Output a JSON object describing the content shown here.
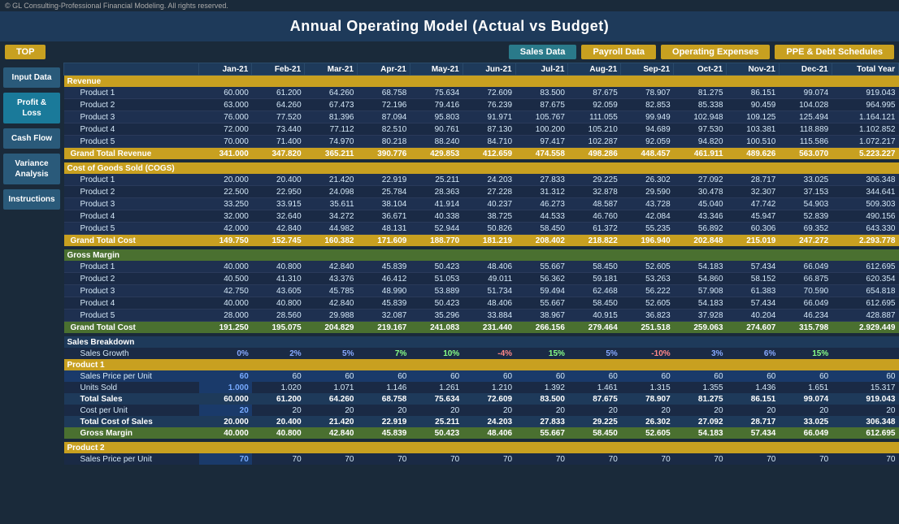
{
  "app": {
    "copyright": "© GL Consulting-Professional Financial Modeling. All rights reserved.",
    "title": "Annual Operating Model (Actual vs Budget)"
  },
  "nav": {
    "top_label": "TOP",
    "buttons": [
      "Sales Data",
      "Payroll Data",
      "Operating Expenses",
      "PPE & Debt Schedules"
    ]
  },
  "sidebar": {
    "items": [
      {
        "label": "Input Data"
      },
      {
        "label": "Profit &\nLoss"
      },
      {
        "label": "Cash Flow"
      },
      {
        "label": "Variance\nAnalysis"
      },
      {
        "label": "Instructions"
      }
    ]
  },
  "columns": [
    "Jan-21",
    "Feb-21",
    "Mar-21",
    "Apr-21",
    "May-21",
    "Jun-21",
    "Jul-21",
    "Aug-21",
    "Sep-21",
    "Oct-21",
    "Nov-21",
    "Dec-21",
    "Total Year"
  ],
  "revenue": {
    "section_label": "Revenue",
    "products": [
      {
        "name": "Product 1",
        "values": [
          "60.000",
          "61.200",
          "64.260",
          "68.758",
          "75.634",
          "72.609",
          "83.500",
          "87.675",
          "78.907",
          "81.275",
          "86.151",
          "99.074",
          "919.043"
        ]
      },
      {
        "name": "Product 2",
        "values": [
          "63.000",
          "64.260",
          "67.473",
          "72.196",
          "79.416",
          "76.239",
          "87.675",
          "92.059",
          "82.853",
          "85.338",
          "90.459",
          "104.028",
          "964.995"
        ]
      },
      {
        "name": "Product 3",
        "values": [
          "76.000",
          "77.520",
          "81.396",
          "87.094",
          "95.803",
          "91.971",
          "105.767",
          "111.055",
          "99.949",
          "102.948",
          "109.125",
          "125.494",
          "1.164.121"
        ]
      },
      {
        "name": "Product 4",
        "values": [
          "72.000",
          "73.440",
          "77.112",
          "82.510",
          "90.761",
          "87.130",
          "100.200",
          "105.210",
          "94.689",
          "97.530",
          "103.381",
          "118.889",
          "1.102.852"
        ]
      },
      {
        "name": "Product 5",
        "values": [
          "70.000",
          "71.400",
          "74.970",
          "80.218",
          "88.240",
          "84.710",
          "97.417",
          "102.287",
          "92.059",
          "94.820",
          "100.510",
          "115.586",
          "1.072.217"
        ]
      }
    ],
    "total_label": "Grand Total Revenue",
    "totals": [
      "341.000",
      "347.820",
      "365.211",
      "390.776",
      "429.853",
      "412.659",
      "474.558",
      "498.286",
      "448.457",
      "461.911",
      "489.626",
      "563.070",
      "5.223.227"
    ]
  },
  "cogs": {
    "section_label": "Cost of Goods Sold (COGS)",
    "products": [
      {
        "name": "Product 1",
        "values": [
          "20.000",
          "20.400",
          "21.420",
          "22.919",
          "25.211",
          "24.203",
          "27.833",
          "29.225",
          "26.302",
          "27.092",
          "28.717",
          "33.025",
          "306.348"
        ]
      },
      {
        "name": "Product 2",
        "values": [
          "22.500",
          "22.950",
          "24.098",
          "25.784",
          "28.363",
          "27.228",
          "31.312",
          "32.878",
          "29.590",
          "30.478",
          "32.307",
          "37.153",
          "344.641"
        ]
      },
      {
        "name": "Product 3",
        "values": [
          "33.250",
          "33.915",
          "35.611",
          "38.104",
          "41.914",
          "40.237",
          "46.273",
          "48.587",
          "43.728",
          "45.040",
          "47.742",
          "54.903",
          "509.303"
        ]
      },
      {
        "name": "Product 4",
        "values": [
          "32.000",
          "32.640",
          "34.272",
          "36.671",
          "40.338",
          "38.725",
          "44.533",
          "46.760",
          "42.084",
          "43.346",
          "45.947",
          "52.839",
          "490.156"
        ]
      },
      {
        "name": "Product 5",
        "values": [
          "42.000",
          "42.840",
          "44.982",
          "48.131",
          "52.944",
          "50.826",
          "58.450",
          "61.372",
          "55.235",
          "56.892",
          "60.306",
          "69.352",
          "643.330"
        ]
      }
    ],
    "total_label": "Grand Total Cost",
    "totals": [
      "149.750",
      "152.745",
      "160.382",
      "171.609",
      "188.770",
      "181.219",
      "208.402",
      "218.822",
      "196.940",
      "202.848",
      "215.019",
      "247.272",
      "2.293.778"
    ]
  },
  "gross_margin": {
    "section_label": "Gross Margin",
    "products": [
      {
        "name": "Product 1",
        "values": [
          "40.000",
          "40.800",
          "42.840",
          "45.839",
          "50.423",
          "48.406",
          "55.667",
          "58.450",
          "52.605",
          "54.183",
          "57.434",
          "66.049",
          "612.695"
        ]
      },
      {
        "name": "Product 2",
        "values": [
          "40.500",
          "41.310",
          "43.376",
          "46.412",
          "51.053",
          "49.011",
          "56.362",
          "59.181",
          "53.263",
          "54.860",
          "58.152",
          "66.875",
          "620.354"
        ]
      },
      {
        "name": "Product 3",
        "values": [
          "42.750",
          "43.605",
          "45.785",
          "48.990",
          "53.889",
          "51.734",
          "59.494",
          "62.468",
          "56.222",
          "57.908",
          "61.383",
          "70.590",
          "654.818"
        ]
      },
      {
        "name": "Product 4",
        "values": [
          "40.000",
          "40.800",
          "42.840",
          "45.839",
          "50.423",
          "48.406",
          "55.667",
          "58.450",
          "52.605",
          "54.183",
          "57.434",
          "66.049",
          "612.695"
        ]
      },
      {
        "name": "Product 5",
        "values": [
          "28.000",
          "28.560",
          "29.988",
          "32.087",
          "35.296",
          "33.884",
          "38.967",
          "40.915",
          "36.823",
          "37.928",
          "40.204",
          "46.234",
          "428.887"
        ]
      }
    ],
    "total_label": "Grand Total Cost",
    "totals": [
      "191.250",
      "195.075",
      "204.829",
      "219.167",
      "241.083",
      "231.440",
      "266.156",
      "279.464",
      "251.518",
      "259.063",
      "274.607",
      "315.798",
      "2.929.449"
    ]
  },
  "sales_breakdown": {
    "section_label": "Sales Breakdown",
    "growth_label": "Sales Growth",
    "growth_values": [
      "0%",
      "2%",
      "5%",
      "7%",
      "10%",
      "-4%",
      "15%",
      "5%",
      "-10%",
      "3%",
      "6%",
      "15%"
    ],
    "product1": {
      "label": "Product 1",
      "price_label": "Sales Price per Unit",
      "price_values": [
        "60",
        "60",
        "60",
        "60",
        "60",
        "60",
        "60",
        "60",
        "60",
        "60",
        "60",
        "60",
        "60"
      ],
      "price_first": "60",
      "units_label": "Units Sold",
      "units_values": [
        "1.000",
        "1.020",
        "1.071",
        "1.146",
        "1.261",
        "1.210",
        "1.392",
        "1.461",
        "1.315",
        "1.355",
        "1.436",
        "1.651",
        "15.317"
      ],
      "units_first": "1.000",
      "total_sales_label": "Total Sales",
      "total_sales_values": [
        "60.000",
        "61.200",
        "64.260",
        "68.758",
        "75.634",
        "72.609",
        "83.500",
        "87.675",
        "78.907",
        "81.275",
        "86.151",
        "99.074",
        "919.043"
      ],
      "cost_label": "Cost per Unit",
      "cost_values": [
        "20",
        "20",
        "20",
        "20",
        "20",
        "20",
        "20",
        "20",
        "20",
        "20",
        "20",
        "20",
        "20"
      ],
      "cost_first": "20",
      "total_cost_label": "Total Cost of Sales",
      "total_cost_values": [
        "20.000",
        "20.400",
        "21.420",
        "22.919",
        "25.211",
        "24.203",
        "27.833",
        "29.225",
        "26.302",
        "27.092",
        "28.717",
        "33.025",
        "306.348"
      ],
      "gross_margin_label": "Gross Margin",
      "gross_margin_values": [
        "40.000",
        "40.800",
        "42.840",
        "45.839",
        "50.423",
        "48.406",
        "55.667",
        "58.450",
        "52.605",
        "54.183",
        "57.434",
        "66.049",
        "612.695"
      ]
    },
    "product2": {
      "label": "Product 2",
      "price_label": "Sales Price per Unit",
      "price_first": "70",
      "price_values": [
        "70",
        "70",
        "70",
        "70",
        "70",
        "70",
        "70",
        "70",
        "70",
        "70",
        "70",
        "70",
        "70"
      ]
    }
  }
}
